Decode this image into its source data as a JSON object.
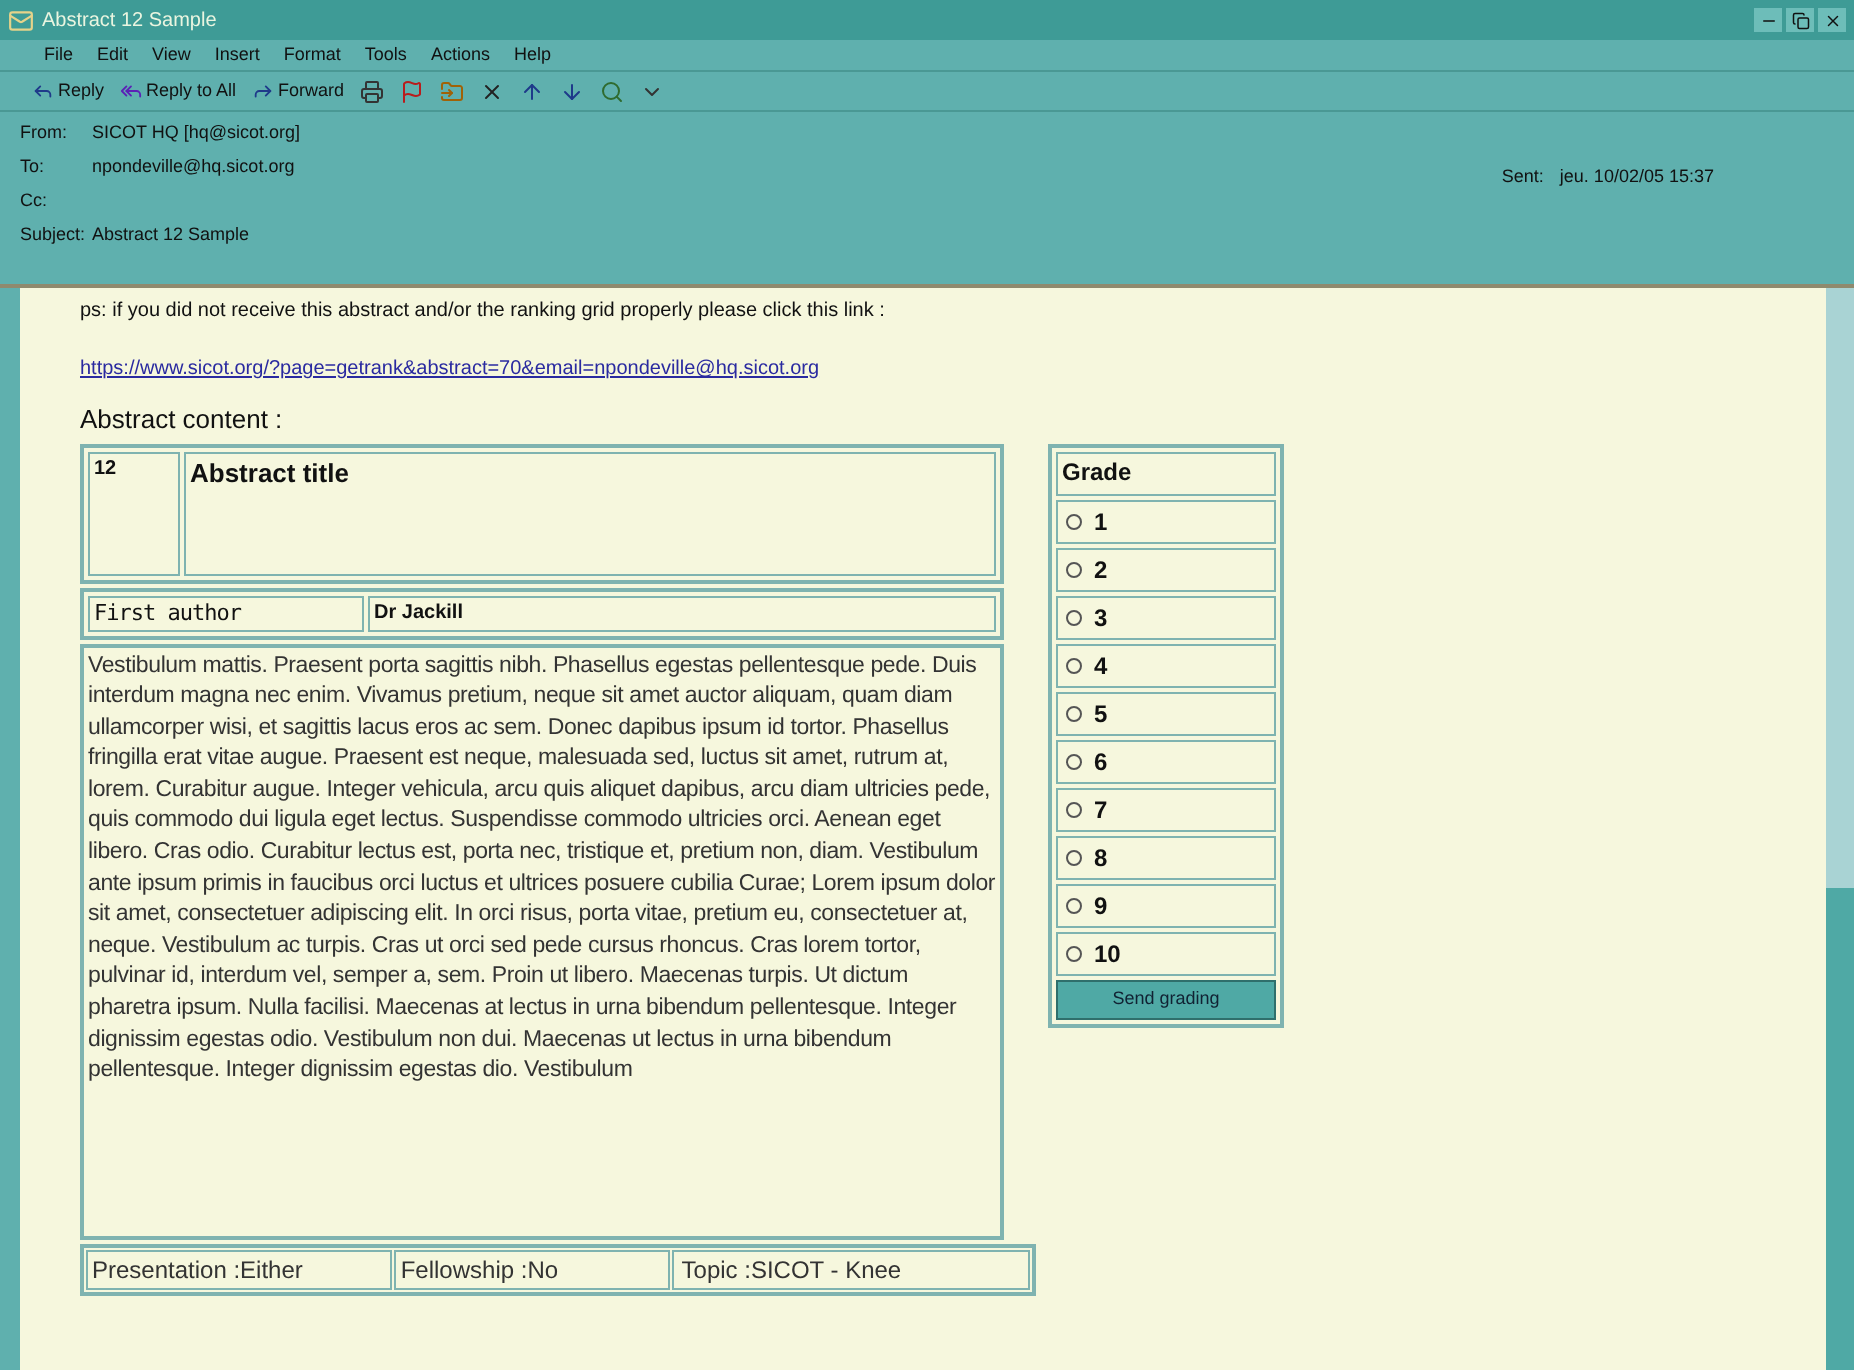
{
  "window": {
    "title": "Abstract 12 Sample"
  },
  "menu": [
    "File",
    "Edit",
    "View",
    "Insert",
    "Format",
    "Tools",
    "Actions",
    "Help"
  ],
  "toolbar": [
    {
      "kind": "reply",
      "label": "Reply"
    },
    {
      "kind": "reply-all",
      "label": "Reply to All"
    },
    {
      "kind": "forward",
      "label": "Forward"
    },
    {
      "kind": "print"
    },
    {
      "kind": "flag"
    },
    {
      "kind": "move"
    },
    {
      "kind": "delete"
    },
    {
      "kind": "previous"
    },
    {
      "kind": "next"
    },
    {
      "kind": "find"
    },
    {
      "kind": "options"
    }
  ],
  "header": {
    "fields": [
      {
        "label": "From:",
        "value": "SICOT HQ [hq@sicot.org]"
      },
      {
        "label": "To:",
        "value": "npondeville@hq.sicot.org"
      },
      {
        "label": "Cc:"
      },
      {
        "label": "Subject:",
        "value": "Abstract 12 Sample"
      }
    ],
    "sent": {
      "label": "Sent:",
      "value": "jeu. 10/02/05 15:37"
    }
  },
  "body": {
    "notice": "ps: if you did not receive this abstract and/or the ranking grid properly please click this link :",
    "link": "https://www.sicot.org/?page=getrank&abstract=70&email=npondeville@hq.sicot.org",
    "section_title": "Abstract content :",
    "abstract": {
      "number": "12",
      "title": "Abstract title",
      "author_label": "First author",
      "author": "Dr Jackill",
      "text": "Vestibulum mattis. Praesent porta sagittis nibh. Phasellus egestas pellentesque pede. Duis interdum magna nec enim. Vivamus pretium, neque sit amet auctor aliquam, quam diam ullamcorper wisi, et sagittis lacus eros ac sem. Donec dapibus ipsum id tortor. Phasellus fringilla erat vitae augue. Praesent est neque, malesuada sed, luctus sit amet, rutrum at, lorem. Curabitur augue. Integer vehicula, arcu quis aliquet dapibus, arcu diam ultricies pede, quis commodo dui ligula eget lectus. Suspendisse commodo ultricies orci. Aenean eget libero. Cras odio. Curabitur lectus est, porta nec, tristique et, pretium non, diam. Vestibulum ante ipsum primis in faucibus orci luctus et ultrices posuere cubilia Curae; Lorem ipsum dolor sit amet, consectetuer adipiscing elit. In orci risus, porta vitae, pretium eu, consectetuer at, neque. Vestibulum ac turpis. Cras ut orci sed pede cursus rhoncus. Cras lorem tortor, pulvinar id, interdum vel, semper a, sem. Proin ut libero. Maecenas turpis. Ut dictum pharetra ipsum. Nulla facilisi. Maecenas at lectus in urna bibendum pellentesque. Integer dignissim egestas odio. Vestibulum non dui.  Maecenas ut lectus in urna bibendum pellentesque. Integer dignissim egestas dio. Vestibulum",
      "meta": [
        "Presentation :Either",
        "Fellowship :No",
        "Topic :SICOT - Knee"
      ]
    },
    "grade": {
      "title": "Grade",
      "options": [
        {
          "label": "1",
          "selected": false
        },
        {
          "label": "2",
          "selected": false
        },
        {
          "label": "3",
          "selected": false
        },
        {
          "label": "4",
          "selected": false
        },
        {
          "label": "5",
          "selected": false
        },
        {
          "label": "6",
          "selected": false
        },
        {
          "label": "7",
          "selected": false
        },
        {
          "label": "8",
          "selected": false
        },
        {
          "label": "9",
          "selected": false
        },
        {
          "label": "10",
          "selected": false
        }
      ],
      "button": "Send grading"
    }
  }
}
